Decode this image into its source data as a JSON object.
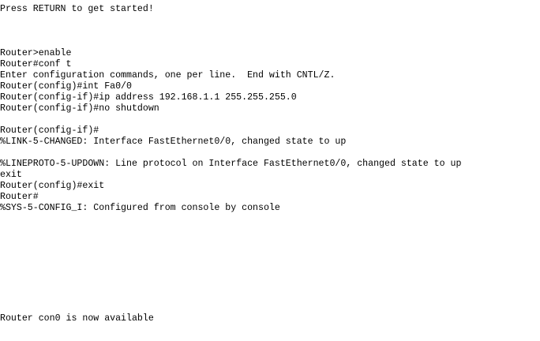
{
  "terminal": {
    "lines": [
      "Press RETURN to get started!",
      "",
      "",
      "",
      "Router>enable",
      "Router#conf t",
      "Enter configuration commands, one per line.  End with CNTL/Z.",
      "Router(config)#int Fa0/0",
      "Router(config-if)#ip address 192.168.1.1 255.255.255.0",
      "Router(config-if)#no shutdown",
      "",
      "Router(config-if)#",
      "%LINK-5-CHANGED: Interface FastEthernet0/0, changed state to up",
      "",
      "%LINEPROTO-5-UPDOWN: Line protocol on Interface FastEthernet0/0, changed state to up",
      "exit",
      "Router(config)#exit",
      "Router#",
      "%SYS-5-CONFIG_I: Configured from console by console",
      "",
      "",
      "",
      "",
      "",
      "",
      "",
      "",
      "",
      "Router con0 is now available"
    ]
  },
  "colors": {
    "background": "#ffffff",
    "text": "#000000"
  }
}
